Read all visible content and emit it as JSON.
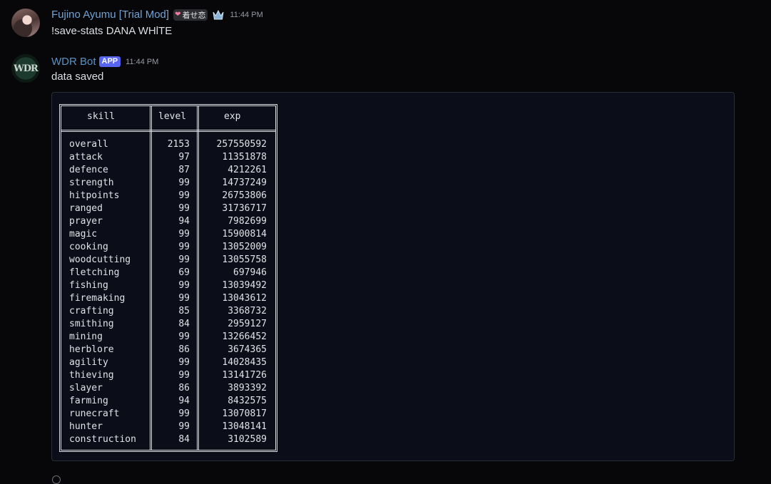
{
  "messages": [
    {
      "username": "Fujino Ayumu [Trial Mod]",
      "tag": {
        "icon": "heart-icon",
        "text": "着せ恋"
      },
      "badge_icon": "crown-icon",
      "time": "11:44 PM",
      "text": "!save-stats DANA WHlTE"
    },
    {
      "username": "WDR Bot",
      "avatar_text": "WDR",
      "app_badge": "APP",
      "time": "11:44 PM",
      "text": "data saved"
    }
  ],
  "table": {
    "headers": [
      "skill",
      "level",
      "exp"
    ],
    "rows": [
      [
        "overall",
        "2153",
        "257550592"
      ],
      [
        "attack",
        "97",
        "11351878"
      ],
      [
        "defence",
        "87",
        "4212261"
      ],
      [
        "strength",
        "99",
        "14737249"
      ],
      [
        "hitpoints",
        "99",
        "26753806"
      ],
      [
        "ranged",
        "99",
        "31736717"
      ],
      [
        "prayer",
        "94",
        "7982699"
      ],
      [
        "magic",
        "99",
        "15900814"
      ],
      [
        "cooking",
        "99",
        "13052009"
      ],
      [
        "woodcutting",
        "99",
        "13055758"
      ],
      [
        "fletching",
        "69",
        "697946"
      ],
      [
        "fishing",
        "99",
        "13039492"
      ],
      [
        "firemaking",
        "99",
        "13043612"
      ],
      [
        "crafting",
        "85",
        "3368732"
      ],
      [
        "smithing",
        "84",
        "2959127"
      ],
      [
        "mining",
        "99",
        "13266452"
      ],
      [
        "herblore",
        "86",
        "3674365"
      ],
      [
        "agility",
        "99",
        "14028435"
      ],
      [
        "thieving",
        "99",
        "13141726"
      ],
      [
        "slayer",
        "86",
        "3893392"
      ],
      [
        "farming",
        "94",
        "8432575"
      ],
      [
        "runecraft",
        "99",
        "13070817"
      ],
      [
        "hunter",
        "99",
        "13048141"
      ],
      [
        "construction",
        "84",
        "3102589"
      ]
    ]
  }
}
